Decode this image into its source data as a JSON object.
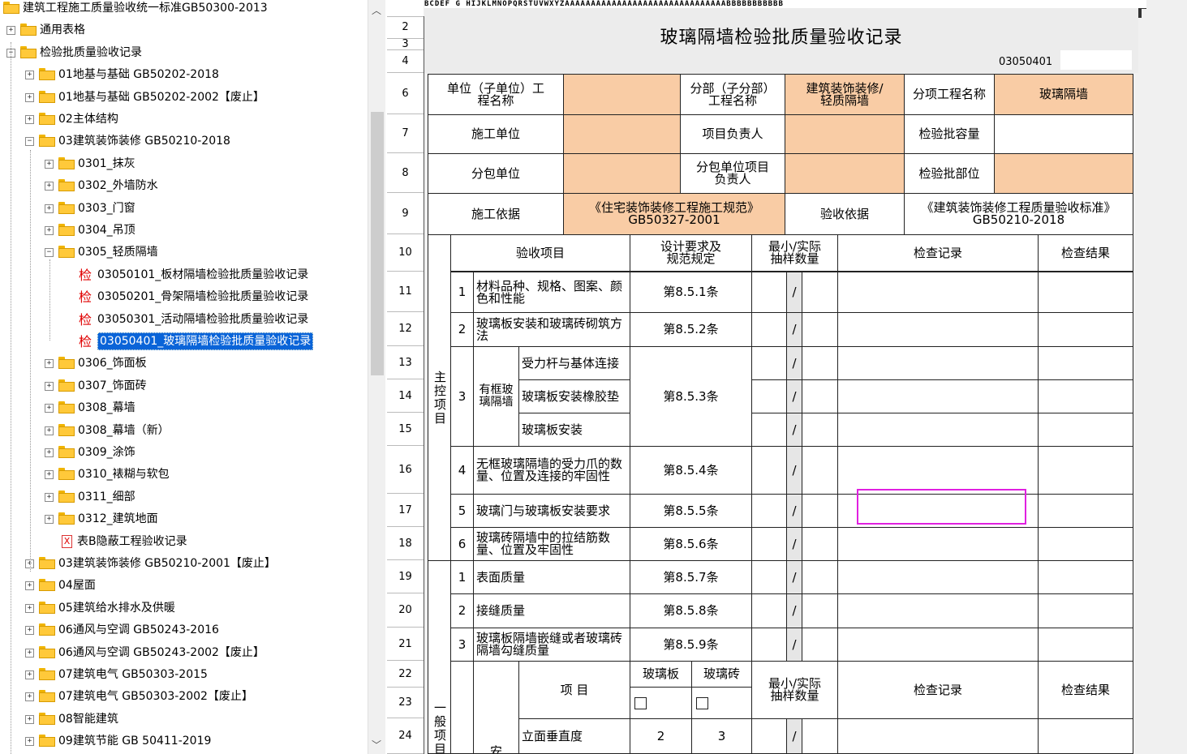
{
  "tree": {
    "items": [
      {
        "label": "建筑工程施工质量验收统一标准GB50300-2013",
        "type": "root"
      },
      {
        "label": "通用表格",
        "type": "folder"
      },
      {
        "label": "检验批质量验收记录",
        "type": "folder"
      },
      {
        "label": "01地基与基础 GB50202-2018",
        "type": "folder"
      },
      {
        "label": "01地基与基础 GB50202-2002【废止】",
        "type": "folder"
      },
      {
        "label": "02主体结构",
        "type": "folder"
      },
      {
        "label": "03建筑装饰装修 GB50210-2018",
        "type": "folder"
      },
      {
        "label": "0301_抹灰",
        "type": "folder"
      },
      {
        "label": "0302_外墙防水",
        "type": "folder"
      },
      {
        "label": "0303_门窗",
        "type": "folder"
      },
      {
        "label": "0304_吊顶",
        "type": "folder"
      },
      {
        "label": "0305_轻质隔墙",
        "type": "folder"
      },
      {
        "label": "03050101_板材隔墙检验批质量验收记录",
        "type": "check",
        "glyph": "检"
      },
      {
        "label": "03050201_骨架隔墙检验批质量验收记录",
        "type": "check",
        "glyph": "检"
      },
      {
        "label": "03050301_活动隔墙检验批质量验收记录",
        "type": "check",
        "glyph": "检"
      },
      {
        "label": "03050401_玻璃隔墙检验批质量验收记录",
        "type": "check",
        "glyph": "检",
        "selected": true
      },
      {
        "label": "0306_饰面板",
        "type": "folder"
      },
      {
        "label": "0307_饰面砖",
        "type": "folder"
      },
      {
        "label": "0308_幕墙",
        "type": "folder"
      },
      {
        "label": "0308_幕墙（新）",
        "type": "folder"
      },
      {
        "label": "0309_涂饰",
        "type": "folder"
      },
      {
        "label": "0310_裱糊与软包",
        "type": "folder"
      },
      {
        "label": "0311_细部",
        "type": "folder"
      },
      {
        "label": "0312_建筑地面",
        "type": "folder"
      },
      {
        "label": "表B隐蔽工程验收记录",
        "type": "doc",
        "glyph": "X"
      },
      {
        "label": "03建筑装饰装修 GB50210-2001【废止】",
        "type": "folder"
      },
      {
        "label": "04屋面",
        "type": "folder"
      },
      {
        "label": "05建筑给水排水及供暖",
        "type": "folder"
      },
      {
        "label": "06通风与空调 GB50243-2016",
        "type": "folder"
      },
      {
        "label": "06通风与空调 GB50243-2002【废止】",
        "type": "folder"
      },
      {
        "label": "07建筑电气 GB50303-2015",
        "type": "folder"
      },
      {
        "label": "07建筑电气 GB50303-2002【废止】",
        "type": "folder"
      },
      {
        "label": "08智能建筑",
        "type": "folder"
      },
      {
        "label": "09建筑节能 GB 50411-2019",
        "type": "folder"
      }
    ]
  },
  "sheet": {
    "col_header": "BCDEF  G HIJKLMNOPQRSTUVWXYZAAAAAAAAAAAAAAAAAAAAAAAAAAAAAAABBBBBBBBBBB",
    "row_numbers": [
      "2",
      "3",
      "4",
      "6",
      "7",
      "8",
      "9",
      "10",
      "11",
      "12",
      "13",
      "14",
      "15",
      "16",
      "17",
      "18",
      "19",
      "20",
      "21",
      "22",
      "23",
      "24"
    ],
    "title": "玻璃隔墙检验批质量验收记录",
    "form_code": "03050401",
    "labels": {
      "unit_name": "单位（子单位）工程名称",
      "sub_division": "分部（子分部）工程名称",
      "sub_division_value": "建筑装饰装修/轻质隔墙",
      "item_name": "分项工程名称",
      "item_value": "玻璃隔墙",
      "contractor": "施工单位",
      "project_lead": "项目负责人",
      "batch_capacity": "检验批容量",
      "subcontractor": "分包单位",
      "sub_lead": "分包单位项目负责人",
      "batch_location": "检验批部位",
      "basis": "施工依据",
      "basis_value": "《住宅装饰装修工程施工规范》GB50327-2001",
      "acceptance_basis": "验收依据",
      "acceptance_value": "《建筑装饰装修工程质量验收标准》GB50210-2018",
      "main_control": "主控项目",
      "general": "一般项目",
      "check_item": "验收项目",
      "design_req": "设计要求及规范规定",
      "min_sample": "最小/实际抽样数量",
      "check_record": "检查记录",
      "check_result": "检查结果",
      "item_col": "项  目",
      "glass_panel": "玻璃板",
      "glass_brick": "玻璃砖",
      "slash": "/",
      "framed": "有框玻璃隔墙",
      "install_partial": "安"
    },
    "main_rows": [
      {
        "no": "1",
        "item": "材料品种、规格、图案、颜色和性能",
        "clause": "第8.5.1条"
      },
      {
        "no": "2",
        "item": "玻璃板安装和玻璃砖砌筑方法",
        "clause": "第8.5.2条"
      },
      {
        "no": "3",
        "sub": [
          "受力杆与基体连接",
          "玻璃板安装橡胶垫",
          "玻璃板安装"
        ],
        "clause": "第8.5.3条"
      },
      {
        "no": "4",
        "item": "无框玻璃隔墙的受力爪的数量、位置及连接的牢固性",
        "clause": "第8.5.4条"
      },
      {
        "no": "5",
        "item": "玻璃门与玻璃板安装要求",
        "clause": "第8.5.5条"
      },
      {
        "no": "6",
        "item": "玻璃砖隔墙中的拉结筋数量、位置及牢固性",
        "clause": "第8.5.6条"
      }
    ],
    "general_rows": [
      {
        "no": "1",
        "item": "表面质量",
        "clause": "第8.5.7条"
      },
      {
        "no": "2",
        "item": "接缝质量",
        "clause": "第8.5.8条"
      },
      {
        "no": "3",
        "item": "玻璃板隔墙嵌缝或者玻璃砖隔墙勾缝质量",
        "clause": "第8.5.9条"
      }
    ],
    "tolerance_row": {
      "item": "立面垂直度",
      "glass_panel": "2",
      "glass_brick": "3"
    }
  },
  "colors": {
    "orange_cell": "#f9cca5",
    "selection": "#0a64d8",
    "highlight": "#e020e0",
    "check_icon": "#e00000"
  }
}
